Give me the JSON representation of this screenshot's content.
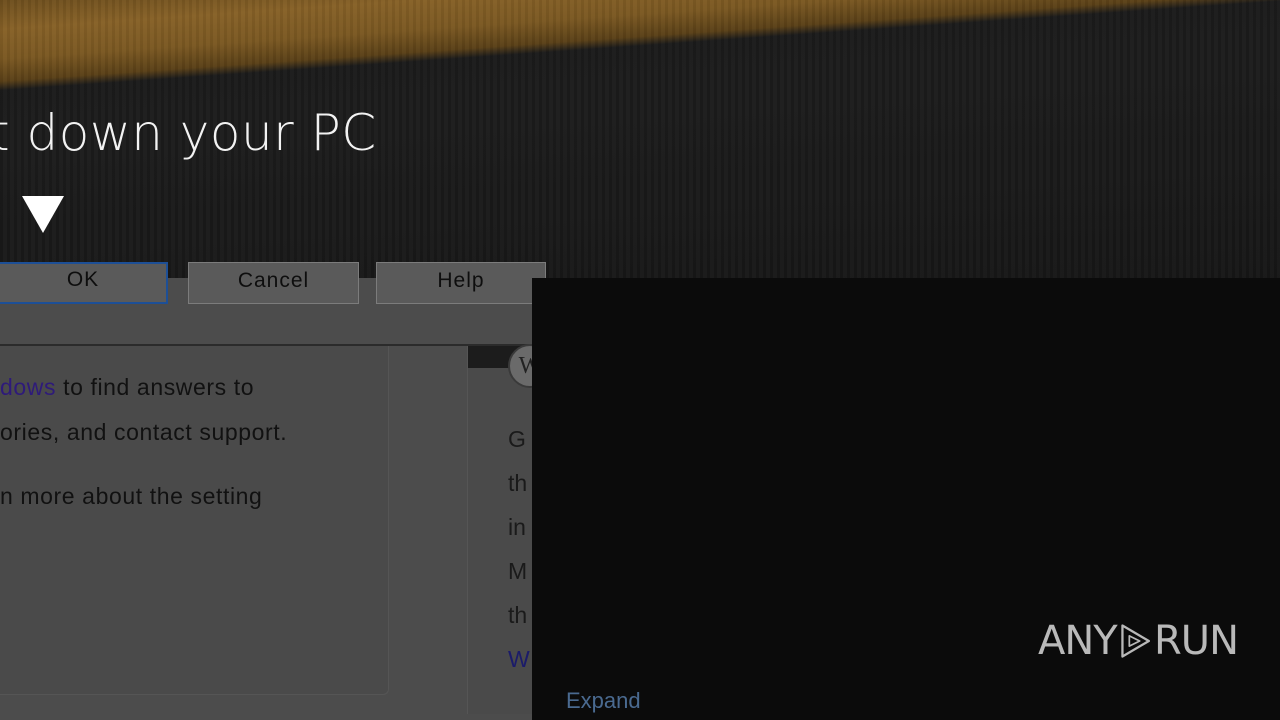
{
  "shutdown": {
    "title": "t down your PC"
  },
  "dialog": {
    "buttons": {
      "ok": "OK",
      "cancel": "Cancel",
      "help": "Help"
    },
    "left_panel": {
      "line1_link": "dows",
      "line1_rest": " to find answers to",
      "line2": "ories, and contact support.",
      "line3": "n more about the setting"
    },
    "right_panel": {
      "badge": "W",
      "lines": [
        "G",
        "th",
        "in",
        "M",
        "th",
        "W"
      ]
    }
  },
  "overlay": {
    "expand": "Expand"
  },
  "watermark": {
    "left": "ANY",
    "right": "RUN"
  },
  "colors": {
    "link": "#2e1a7a",
    "expand": "#4a6a90",
    "ok_border": "#1d4f96"
  }
}
